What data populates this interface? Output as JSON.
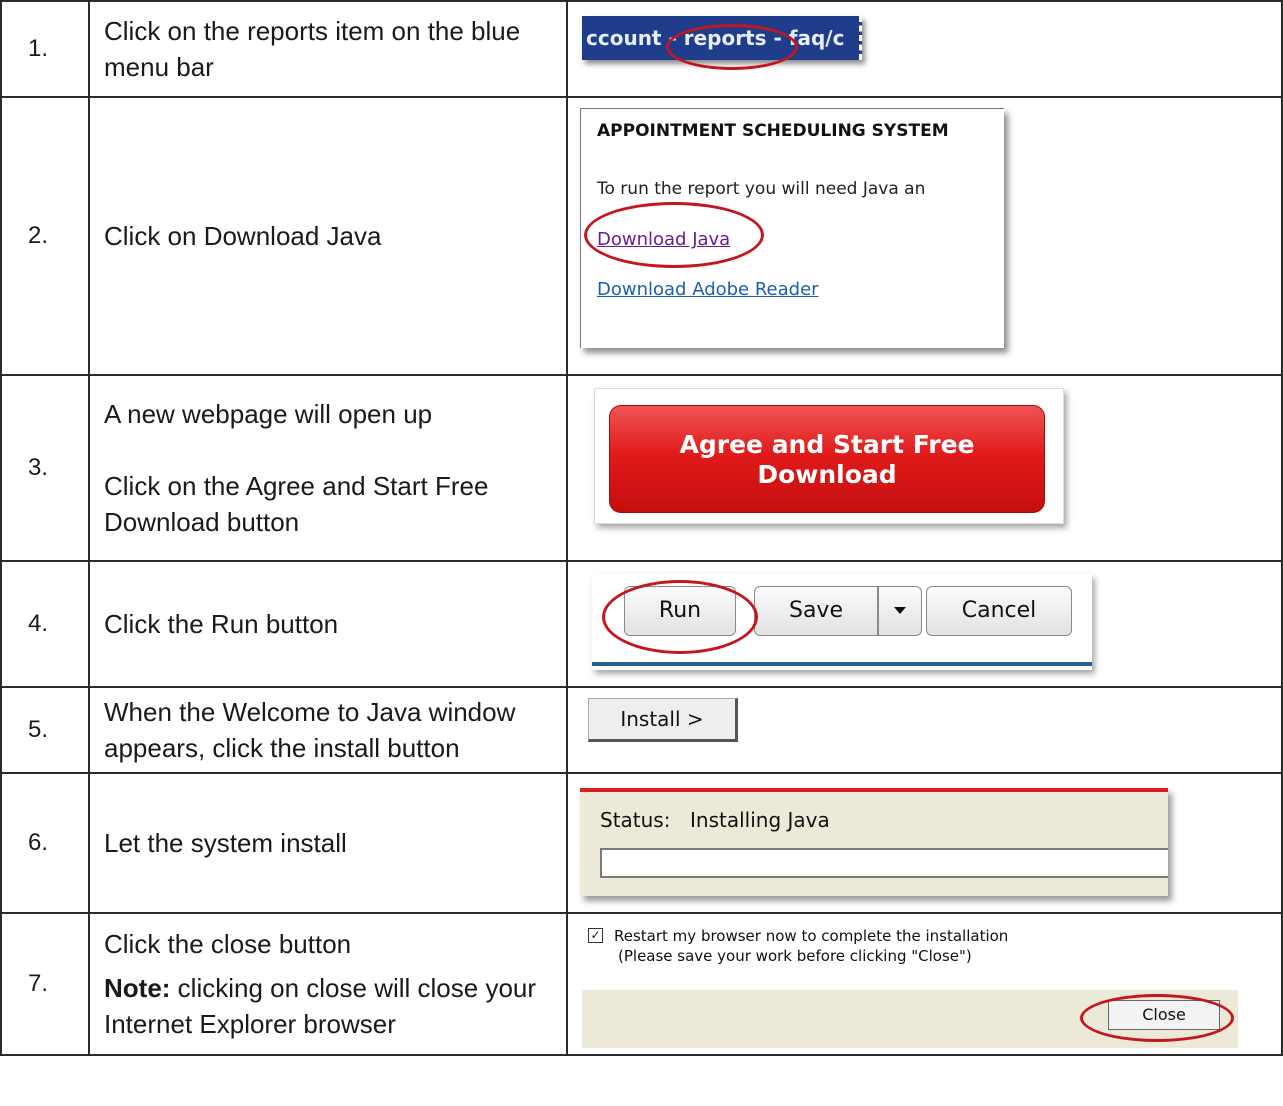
{
  "steps": [
    {
      "num": "1.",
      "lines": [
        "Click on the reports item on the blue menu bar"
      ],
      "shot": {
        "menu_text": [
          "ccount",
          "- reports -",
          "faq/c"
        ],
        "menu_color": "#1f3d8a"
      }
    },
    {
      "num": "2.",
      "lines": [
        "Click on Download Java"
      ],
      "shot": {
        "heading": "APPOINTMENT SCHEDULING SYSTEM",
        "text": "To run the report you will need Java an",
        "link1": "Download Java",
        "link2": "Download Adobe Reader"
      }
    },
    {
      "num": "3.",
      "lines": [
        "A new webpage will open up",
        "Click on the Agree and Start Free Download button"
      ],
      "shot": {
        "button_line1": "Agree and Start Free",
        "button_line2": "Download",
        "button_color": "#e11b1b"
      }
    },
    {
      "num": "4.",
      "lines": [
        "Click the Run button"
      ],
      "shot": {
        "run": "Run",
        "save": "Save",
        "cancel": "Cancel"
      }
    },
    {
      "num": "5.",
      "lines": [
        "When the Welcome to Java window appears, click the install button"
      ],
      "shot": {
        "install": "Install >"
      }
    },
    {
      "num": "6.",
      "lines": [
        "Let the system install"
      ],
      "shot": {
        "status_label": "Status:",
        "status_value": "Installing Java"
      }
    },
    {
      "num": "7.",
      "lines": [
        "Click the close button"
      ],
      "note_label": "Note:",
      "note_text": " clicking on close will close your Internet Explorer browser",
      "shot": {
        "checkbox_mark": "✓",
        "restart_text": "Restart my browser now to complete the installation",
        "save_hint": "(Please save your work before clicking \"Close\")",
        "close": "Close"
      }
    }
  ],
  "colors": {
    "highlight_ellipse": "#c4161c",
    "border": "#2b2b2b"
  }
}
